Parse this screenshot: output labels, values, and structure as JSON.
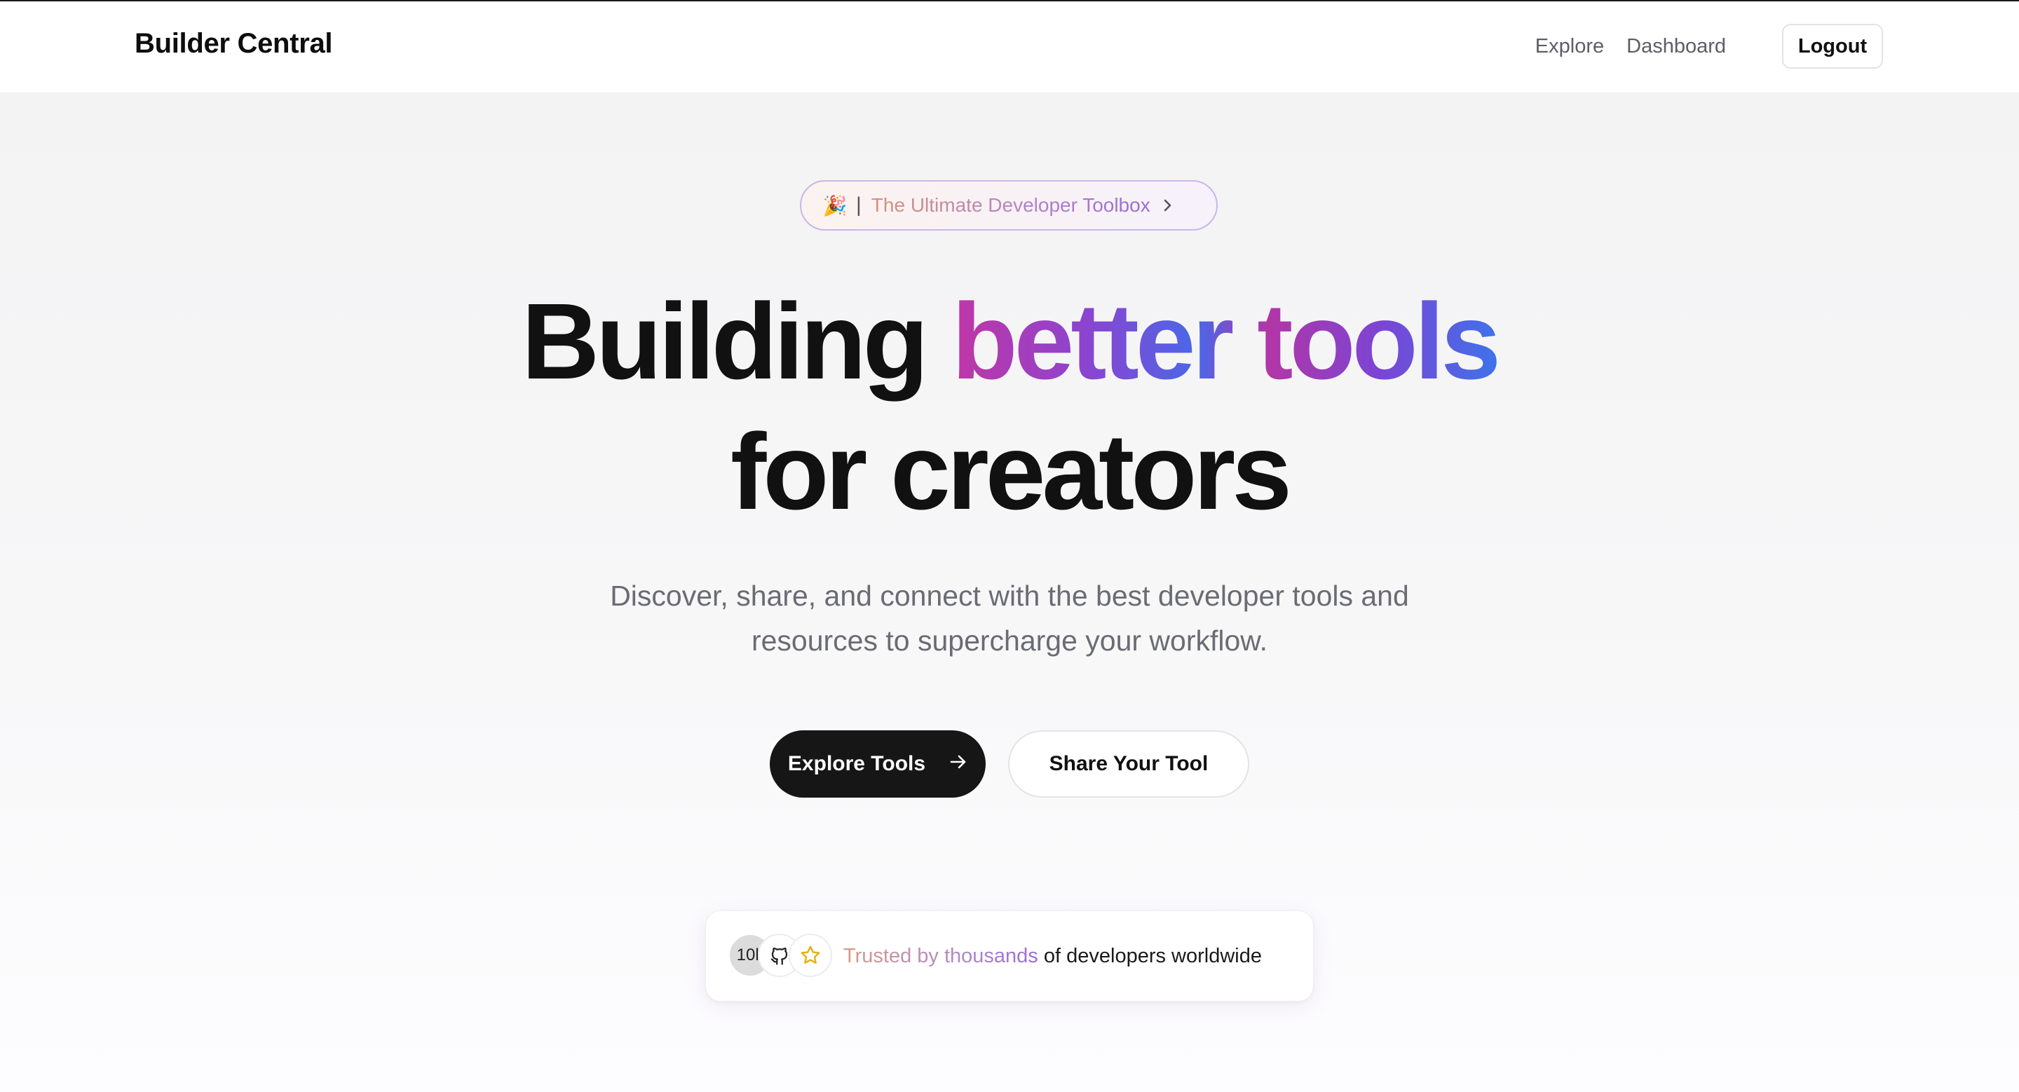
{
  "nav": {
    "brand": "Builder Central",
    "links": [
      "Explore",
      "Dashboard"
    ],
    "logout_label": "Logout"
  },
  "badge": {
    "emoji": "🎉",
    "separator": "|",
    "text": "The Ultimate Developer Toolbox",
    "icon": "chevron-right-icon"
  },
  "hero": {
    "line1_plain": "Building",
    "line1_gradient": "better tools",
    "line2": "for creators",
    "subtitle_line1": "Discover, share, and connect with the best developer tools and",
    "subtitle_line2": "resources to supercharge your workflow."
  },
  "actions": {
    "primary_label": "Explore Tools",
    "primary_icon": "arrow-right-icon",
    "secondary_label": "Share Your Tool"
  },
  "trust": {
    "avatars": [
      {
        "type": "text",
        "value": "10k"
      },
      {
        "type": "icon",
        "value": "github-icon"
      },
      {
        "type": "icon",
        "value": "star-icon"
      }
    ],
    "text_gradient": "Trusted by thousands",
    "text_plain": "of developers worldwide"
  },
  "colors": {
    "gradient_start": "#c136a6",
    "gradient_mid": "#8a45d0",
    "gradient_end": "#3f72ea",
    "primary_button": "#161616",
    "star": "#e3b21c"
  }
}
